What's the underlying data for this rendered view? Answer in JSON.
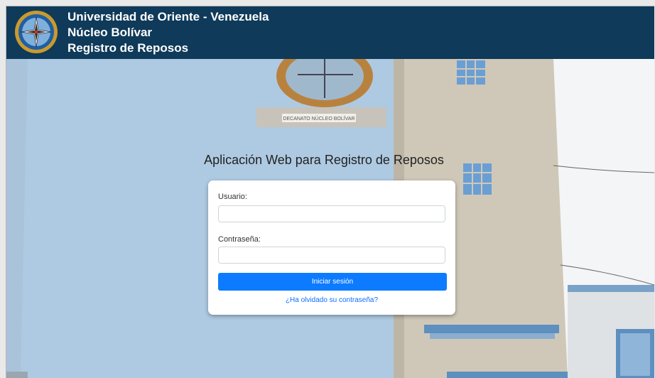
{
  "header": {
    "line1": "Universidad de Oriente - Venezuela",
    "line2": "Núcleo Bolívar",
    "line3": "Registro de Reposos",
    "logo_icon": "university-seal-icon",
    "background_color": "#0f3a5a"
  },
  "background": {
    "building_sign": "DECANATO NÚCLEO BOLÍVAR"
  },
  "main": {
    "title": "Aplicación Web para Registro de Reposos"
  },
  "login": {
    "username_label": "Usuario:",
    "username_value": "",
    "password_label": "Contraseña:",
    "password_value": "",
    "submit_label": "Iniciar sesión",
    "forgot_label": "¿Ha olvidado su contraseña?",
    "accent_color": "#0d7bff"
  }
}
